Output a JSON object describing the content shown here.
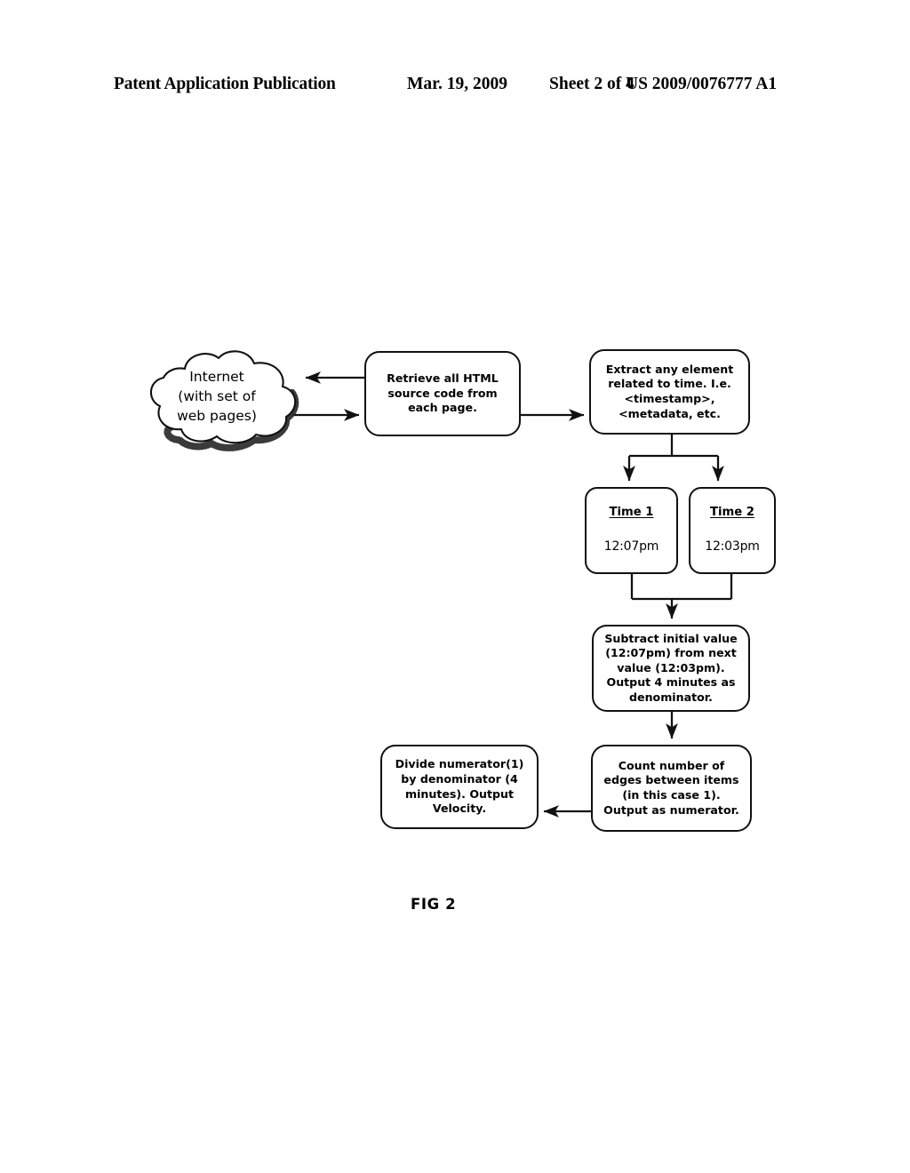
{
  "header": {
    "publication": "Patent Application Publication",
    "date": "Mar. 19, 2009",
    "sheet": "Sheet 2 of 4",
    "patent_number": "US 2009/0076777 A1"
  },
  "figure": {
    "caption": "FIG 2",
    "line_color": "#111111",
    "background": "#ffffff"
  },
  "nodes": {
    "cloud": {
      "label": "Internet\n(with set of\nweb pages)",
      "shape": "cloud"
    },
    "retrieve": {
      "label": "Retrieve all HTML\nsource code from\neach page.",
      "shape": "rounded-rect"
    },
    "extract": {
      "label": "Extract any element\nrelated to time.  I.e.\n<timestamp>,\n<metadata, etc.",
      "shape": "rounded-rect"
    },
    "time1": {
      "title": "Time 1",
      "value": "12:07pm",
      "shape": "rounded-rect"
    },
    "time2": {
      "title": "Time 2",
      "value": "12:03pm",
      "shape": "rounded-rect"
    },
    "subtract": {
      "label": "Subtract initial value\n(12:07pm) from next\nvalue (12:03pm).\nOutput 4 minutes as\ndenominator.",
      "shape": "rounded-rect"
    },
    "count": {
      "label": "Count number of\nedges between items\n(in this case 1).\nOutput as numerator.",
      "shape": "rounded-rect"
    },
    "divide": {
      "label": "Divide numerator(1)\nby denominator (4\nminutes).  Output\nVelocity.",
      "shape": "rounded-rect"
    }
  },
  "edges": [
    {
      "from": "retrieve",
      "to": "cloud",
      "direction": "left"
    },
    {
      "from": "cloud",
      "to": "retrieve",
      "direction": "right"
    },
    {
      "from": "retrieve",
      "to": "extract",
      "direction": "right"
    },
    {
      "from": "extract",
      "to": "time1",
      "direction": "down"
    },
    {
      "from": "extract",
      "to": "time2",
      "direction": "down"
    },
    {
      "from": "time1",
      "to": "subtract",
      "direction": "down"
    },
    {
      "from": "time2",
      "to": "subtract",
      "direction": "down"
    },
    {
      "from": "subtract",
      "to": "count",
      "direction": "down"
    },
    {
      "from": "count",
      "to": "divide",
      "direction": "left"
    }
  ]
}
